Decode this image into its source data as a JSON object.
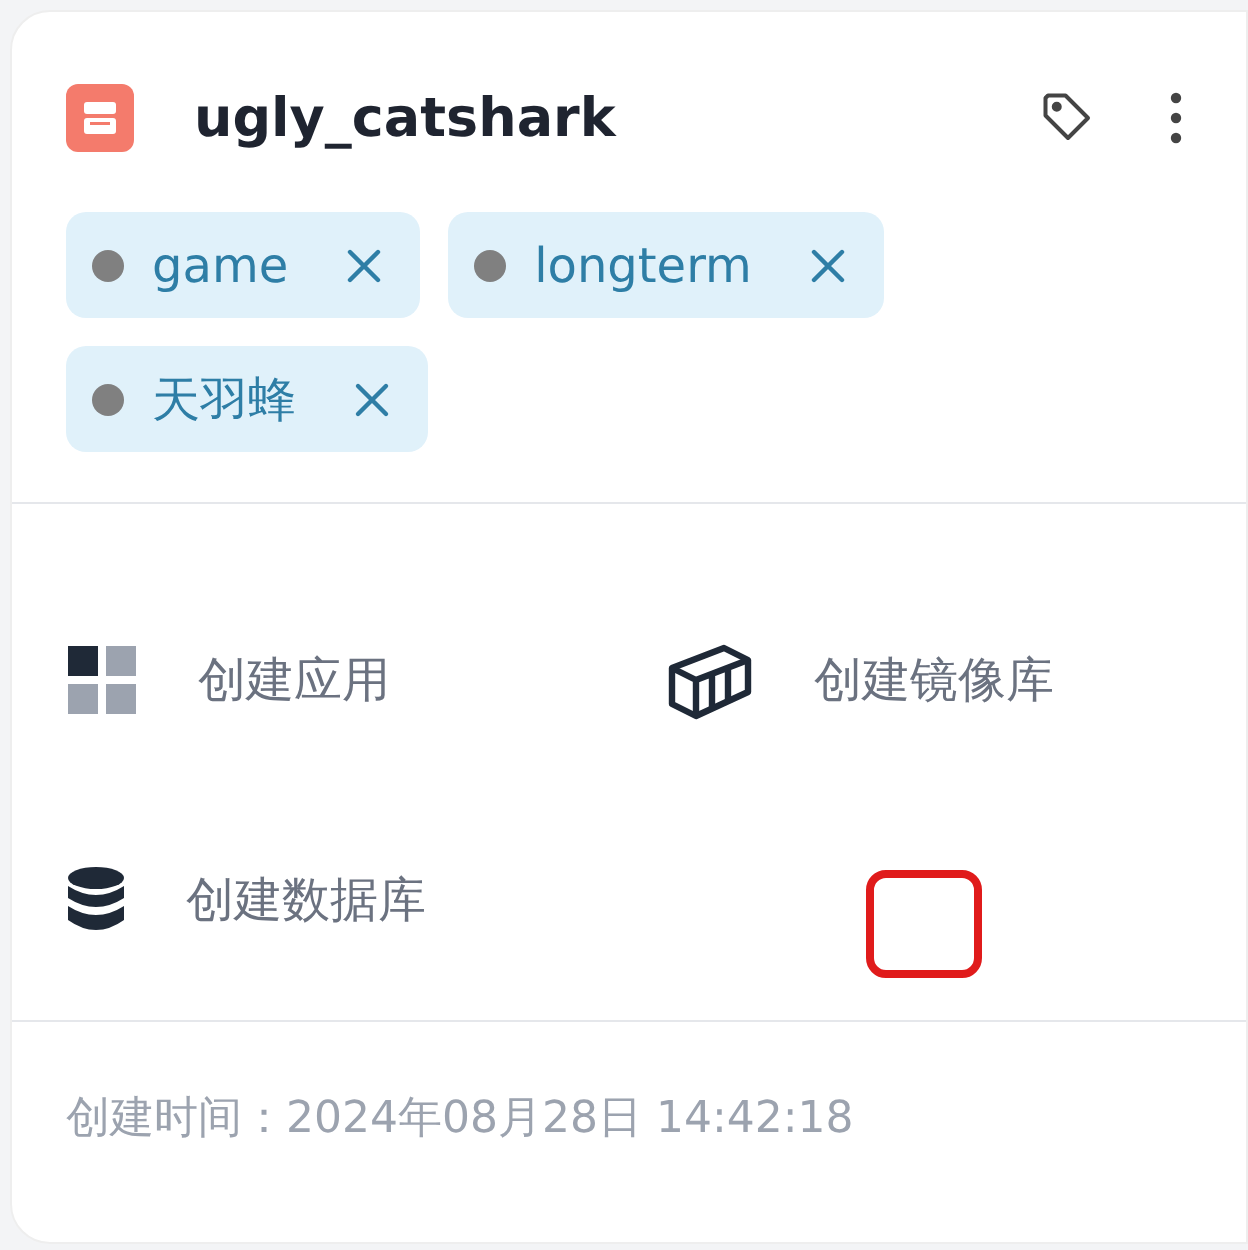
{
  "card": {
    "title": "ugly_catshark",
    "tags": [
      {
        "label": "game",
        "color": "#808080"
      },
      {
        "label": "longterm",
        "color": "#808080"
      },
      {
        "label": "天羽蜂",
        "color": "#808080"
      }
    ],
    "actions": [
      {
        "kind": "apps",
        "label": "创建应用"
      },
      {
        "kind": "container",
        "label": "创建镜像库"
      },
      {
        "kind": "database",
        "label": "创建数据库"
      }
    ],
    "created": "创建时间：2024年08月28日 14:42:18"
  }
}
